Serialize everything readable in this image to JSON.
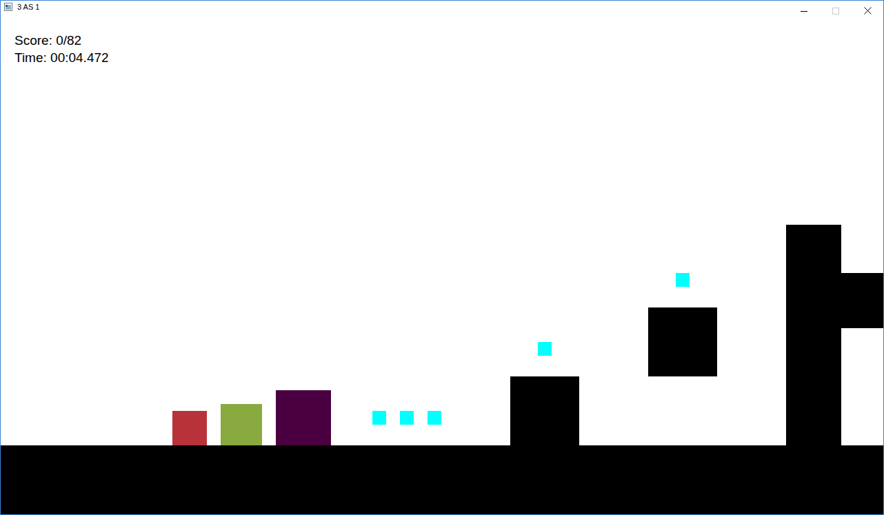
{
  "window": {
    "title": "3 AS 1"
  },
  "hud": {
    "score": "Score: 0/82",
    "time": "Time: 00:04.472"
  },
  "players": [
    {
      "color": "#b83239"
    },
    {
      "color": "#88aa3f"
    },
    {
      "color": "#4a0040"
    }
  ]
}
